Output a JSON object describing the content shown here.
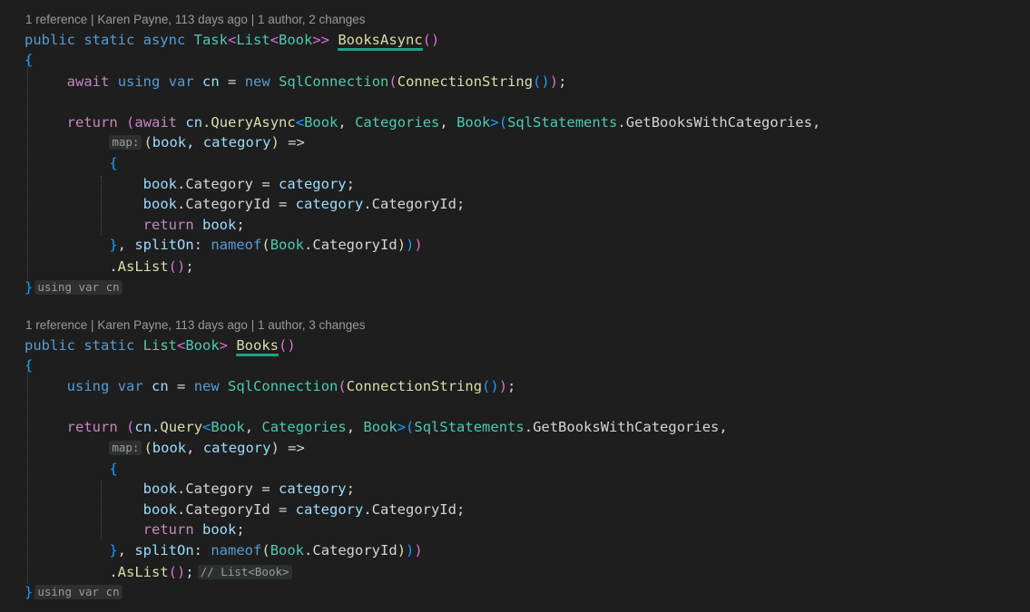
{
  "method1": {
    "codelens": {
      "references": "1 reference",
      "author": "Karen Payne, 113 days ago",
      "changes": "1 author, 2 changes"
    },
    "inlay_map": "map:",
    "inlay_block_end": "using var cn"
  },
  "method2": {
    "codelens": {
      "references": "1 reference",
      "author": "Karen Payne, 113 days ago",
      "changes": "1 author, 3 changes"
    },
    "inlay_map": "map:",
    "inlay_type": "// List<Book>",
    "inlay_block_end": "using var cn"
  },
  "code": {
    "m1_sig": {
      "p1": "public static async ",
      "t1": "Task",
      "lt1": "<",
      "t2": "List",
      "lt2": "<",
      "t3": "Book",
      "gt": ">>",
      "name": "BooksAsync",
      "parens": "()"
    },
    "m2_sig": {
      "p1": "public static ",
      "t1": "List",
      "lt": "<",
      "t2": "Book",
      "gt": ">",
      "name": "Books",
      "parens": "()"
    },
    "brace_open": "{",
    "brace_close": "}",
    "inner_open": "{",
    "inner_close": "}",
    "await": "await",
    "using": "using",
    "var": "var",
    "cn": "cn",
    "eq": " = ",
    "new": "new",
    "sqlconn": "SqlConnection",
    "connstr": "ConnectionString",
    "return": "return",
    "query_async": "QueryAsync",
    "query": "Query",
    "book_type": "Book",
    "categories_type": "Categories",
    "sql_statements": "SqlStatements",
    "get_books_with_categories": "GetBooksWithCategories",
    "book": "book",
    "category": "category",
    "arrow": " =>",
    "category_prop": "Category",
    "category_id_prop": "CategoryId",
    "split_on": "splitOn",
    "nameof": "nameof",
    "as_list": "AsList"
  }
}
